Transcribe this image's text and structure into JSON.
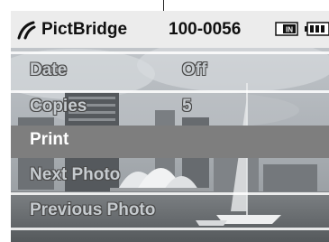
{
  "header": {
    "app_title": "PictBridge",
    "folder_file": "100-0056",
    "icons": [
      "pictbridge-icon",
      "memory-card-icon",
      "battery-icon"
    ],
    "card_badge": "IN"
  },
  "menu": {
    "items": [
      {
        "label": "Date",
        "value": "Off"
      },
      {
        "label": "Copies",
        "value": "5"
      },
      {
        "label": "Print"
      },
      {
        "label": "Next Photo"
      },
      {
        "label": "Previous Photo"
      }
    ],
    "selected_index": 2
  },
  "colors": {
    "header_bg": "#ececec",
    "selected_row": "#7e7e7e",
    "menu_text": "#c6cbcf",
    "selected_text": "#ffffff"
  }
}
